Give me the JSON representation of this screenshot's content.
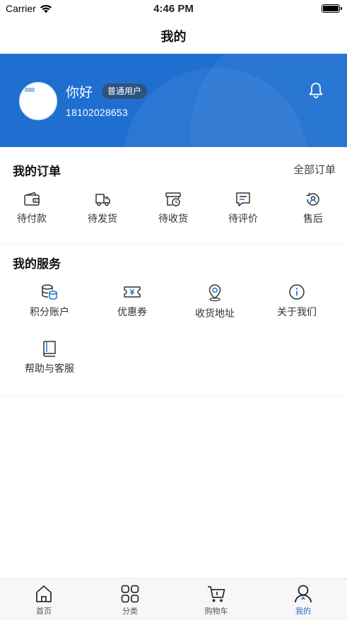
{
  "status_bar": {
    "carrier": "Carrier",
    "time": "4:46 PM"
  },
  "nav": {
    "title": "我的"
  },
  "profile": {
    "greeting": "你好",
    "badge": "普通用户",
    "phone": "18102028653"
  },
  "orders": {
    "title": "我的订单",
    "more": "全部订单",
    "items": [
      {
        "label": "待付款",
        "icon": "wallet-icon"
      },
      {
        "label": "待发货",
        "icon": "truck-icon"
      },
      {
        "label": "待收货",
        "icon": "package-clock-icon"
      },
      {
        "label": "待评价",
        "icon": "comment-icon"
      },
      {
        "label": "售后",
        "icon": "refresh-user-icon"
      }
    ]
  },
  "services": {
    "title": "我的服务",
    "items": [
      {
        "label": "积分账户",
        "icon": "coins-icon"
      },
      {
        "label": "优惠券",
        "icon": "coupon-icon"
      },
      {
        "label": "收货地址",
        "icon": "location-pin-icon"
      },
      {
        "label": "关于我们",
        "icon": "info-icon"
      },
      {
        "label": "帮助与客服",
        "icon": "book-icon"
      }
    ]
  },
  "tabbar": {
    "items": [
      {
        "label": "首页",
        "icon": "home-icon",
        "active": false
      },
      {
        "label": "分类",
        "icon": "grid-icon",
        "active": false
      },
      {
        "label": "购物车",
        "icon": "cart-icon",
        "active": false
      },
      {
        "label": "我的",
        "icon": "user-icon",
        "active": true
      }
    ]
  },
  "colors": {
    "primary": "#1f6fd1",
    "text": "#222222",
    "muted": "#555555"
  }
}
